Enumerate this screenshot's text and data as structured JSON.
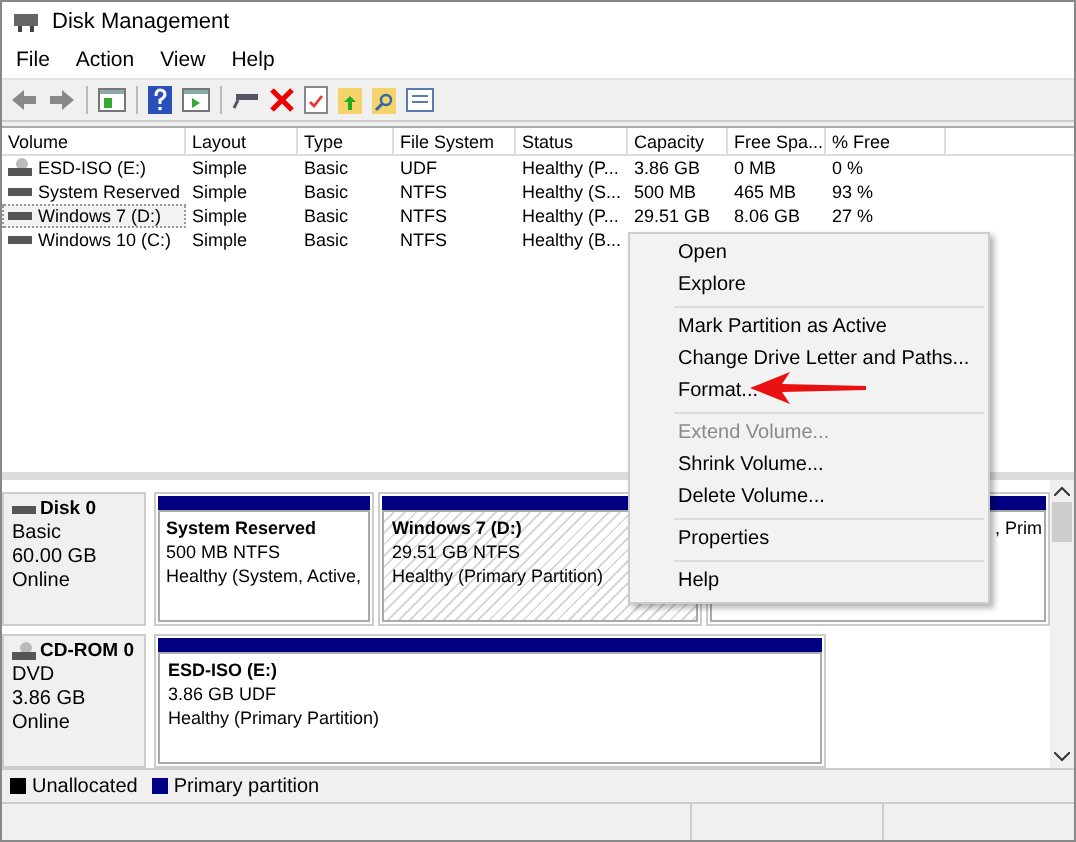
{
  "window": {
    "title": "Disk Management"
  },
  "menu_bar": [
    "File",
    "Action",
    "View",
    "Help"
  ],
  "volume_table": {
    "columns": [
      "Volume",
      "Layout",
      "Type",
      "File System",
      "Status",
      "Capacity",
      "Free Spa...",
      "% Free"
    ],
    "rows": [
      {
        "kind": "cd",
        "selected": false,
        "cells": [
          "ESD-ISO (E:)",
          "Simple",
          "Basic",
          "UDF",
          "Healthy (P...",
          "3.86 GB",
          "0 MB",
          "0 %"
        ]
      },
      {
        "kind": "disk",
        "selected": false,
        "cells": [
          "System Reserved",
          "Simple",
          "Basic",
          "NTFS",
          "Healthy (S...",
          "500 MB",
          "465 MB",
          "93 %"
        ]
      },
      {
        "kind": "disk",
        "selected": true,
        "cells": [
          "Windows 7 (D:)",
          "Simple",
          "Basic",
          "NTFS",
          "Healthy (P...",
          "29.51 GB",
          "8.06 GB",
          "27 %"
        ]
      },
      {
        "kind": "disk",
        "selected": false,
        "cells": [
          "Windows 10 (C:)",
          "Simple",
          "Basic",
          "NTFS",
          "Healthy (B..."
        ]
      }
    ]
  },
  "disks": [
    {
      "kind": "disk",
      "name": "Disk 0",
      "lines": [
        "Basic",
        "60.00 GB",
        "Online"
      ],
      "partitions": [
        {
          "name": "System Reserved",
          "size": "500 MB NTFS",
          "status": "Healthy (System, Active,",
          "selected": false
        },
        {
          "name": "Windows 7  (D:)",
          "size": "29.51 GB NTFS",
          "status": "Healthy (Primary Partition)",
          "selected": true
        },
        {
          "status": ", Prim",
          "selected": false
        }
      ]
    },
    {
      "kind": "cd",
      "name": "CD-ROM 0",
      "lines": [
        "DVD",
        "3.86 GB",
        "Online"
      ],
      "partitions": [
        {
          "name": "ESD-ISO  (E:)",
          "size": "3.86 GB UDF",
          "status": "Healthy (Primary Partition)",
          "selected": false
        }
      ]
    }
  ],
  "legend": [
    {
      "label": "Unallocated",
      "color": "#000000"
    },
    {
      "label": "Primary partition",
      "color": "#000080"
    }
  ],
  "context_menu": [
    {
      "kind": "item",
      "label": "Open",
      "disabled": false
    },
    {
      "kind": "item",
      "label": "Explore",
      "disabled": false
    },
    {
      "kind": "separator"
    },
    {
      "kind": "item",
      "label": "Mark Partition as Active",
      "disabled": false
    },
    {
      "kind": "item",
      "label": "Change Drive Letter and Paths...",
      "disabled": false
    },
    {
      "kind": "item",
      "label": "Format...",
      "disabled": false
    },
    {
      "kind": "separator"
    },
    {
      "kind": "item",
      "label": "Extend Volume...",
      "disabled": true
    },
    {
      "kind": "item",
      "label": "Shrink Volume...",
      "disabled": false
    },
    {
      "kind": "item",
      "label": "Delete Volume...",
      "disabled": false
    },
    {
      "kind": "separator"
    },
    {
      "kind": "item",
      "label": "Properties",
      "disabled": false
    },
    {
      "kind": "separator"
    },
    {
      "kind": "item",
      "label": "Help",
      "disabled": false
    }
  ]
}
